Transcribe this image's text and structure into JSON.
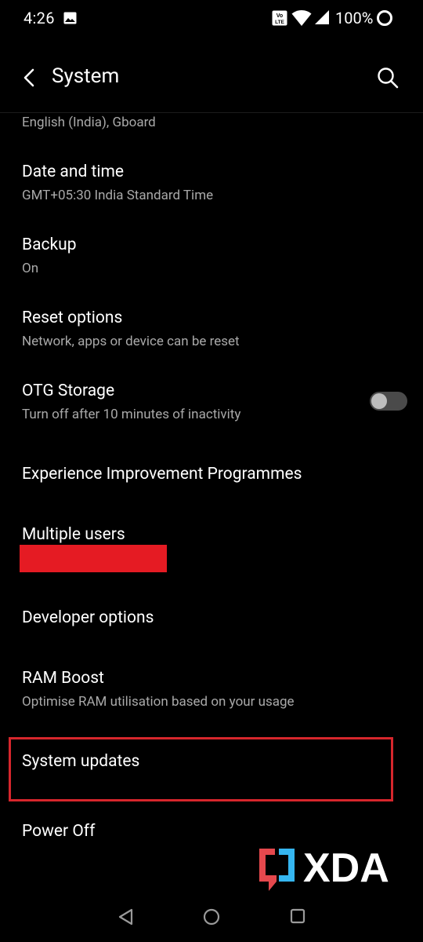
{
  "status_bar": {
    "time": "4:26",
    "battery": "100%",
    "icons": [
      "gallery-icon",
      "volte-icon",
      "wifi-icon",
      "signal-icon",
      "battery-icon"
    ]
  },
  "app_bar": {
    "title": "System",
    "back_icon": "back-arrow-icon",
    "search_icon": "search-icon"
  },
  "settings": [
    {
      "title": "",
      "subtitle": "English (India), Gboard"
    },
    {
      "title": "Date and time",
      "subtitle": "GMT+05:30 India Standard Time"
    },
    {
      "title": "Backup",
      "subtitle": "On"
    },
    {
      "title": "Reset options",
      "subtitle": "Network, apps or device can be reset"
    },
    {
      "title": "OTG Storage",
      "subtitle": "Turn off after 10 minutes of inactivity",
      "toggle": "off"
    },
    {
      "title": "Experience Improvement Programmes",
      "subtitle": ""
    },
    {
      "title": "Multiple users",
      "subtitle": ""
    },
    {
      "title": "Developer options",
      "subtitle": ""
    },
    {
      "title": "RAM Boost",
      "subtitle": "Optimise RAM utilisation based on your usage"
    },
    {
      "title": "System updates",
      "subtitle": ""
    },
    {
      "title": "Power Off",
      "subtitle": ""
    }
  ],
  "watermark": {
    "text": "XDA"
  },
  "colors": {
    "background": "#000000",
    "primary_text": "#ffffff",
    "secondary_text": "#a9a9a9",
    "redaction": "#e51b23",
    "highlight_border": "#d6262c",
    "xda_red": "#e5484d",
    "xda_blue": "#35b6f0"
  },
  "nav_bar": {
    "icons": [
      "nav-back-icon",
      "nav-home-icon",
      "nav-recents-icon"
    ]
  }
}
